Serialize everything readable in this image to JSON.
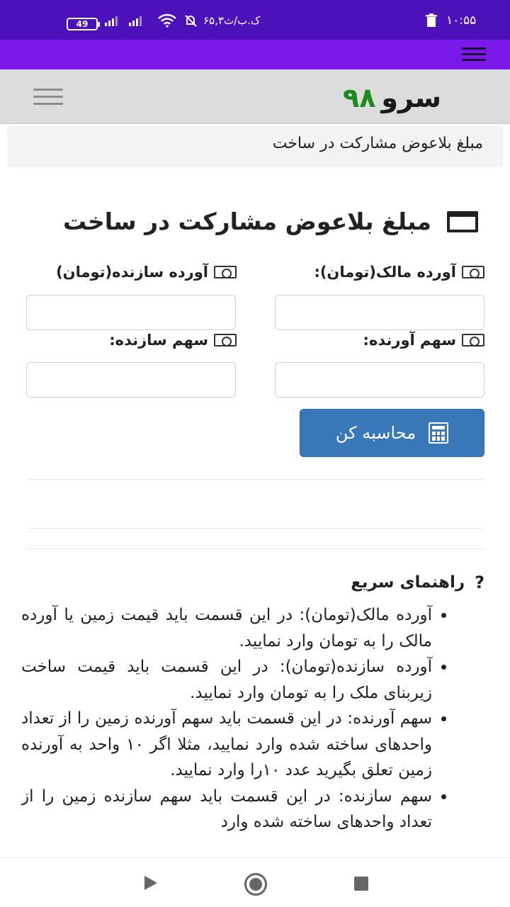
{
  "status_bar": {
    "time": "۱۰:۵۵",
    "battery": "49",
    "network_speed": "۶۵,۳ک.ب/ث",
    "icons": [
      "battery-icon",
      "signal-icon",
      "wifi-icon",
      "bell-off-icon",
      "trash-icon"
    ]
  },
  "header": {
    "logo_word": "سرو",
    "logo_number": "۹۸"
  },
  "breadcrumb": "مبلغ بلاعوض مشارکت در ساخت",
  "page": {
    "title": "مبلغ بلاعوض مشارکت در ساخت"
  },
  "form": {
    "owner_contribution_label": "آورده مالک(تومان):",
    "builder_contribution_label": "آورده سازنده(تومان)",
    "contributor_share_label": "سهم آورنده:",
    "builder_share_label": "سهم سازنده:",
    "owner_contribution_value": "",
    "builder_contribution_value": "",
    "contributor_share_value": "",
    "builder_share_value": "",
    "calculate_button": "محاسبه کن"
  },
  "guide": {
    "title": "راهنمای سریع",
    "items": [
      "آورده مالک(تومان): در این قسمت باید قیمت زمین یا آورده مالک را به تومان وارد نمایید.",
      "آورده سازنده(تومان): در این قسمت باید قیمت ساخت زیربنای ملک را به تومان وارد نمایید.",
      "سهم آورنده: در این قسمت باید سهم آورنده زمین را از تعداد واحدهای ساخته شده وارد نمایید، مثلا اگر ۱۰ واحد به آورنده زمین تعلق بگیرید عدد ۱۰را وارد نمایید.",
      "سهم سازنده: در این قسمت باید سهم سازنده زمین را از تعداد واحدهای ساخته شده وارد"
    ]
  },
  "colors": {
    "status_bar": "#4c11b8",
    "app_bar": "#7b1ae8",
    "header_bg": "#dcdcdc",
    "logo_number": "#1d8a1d",
    "button": "#3878b9"
  }
}
